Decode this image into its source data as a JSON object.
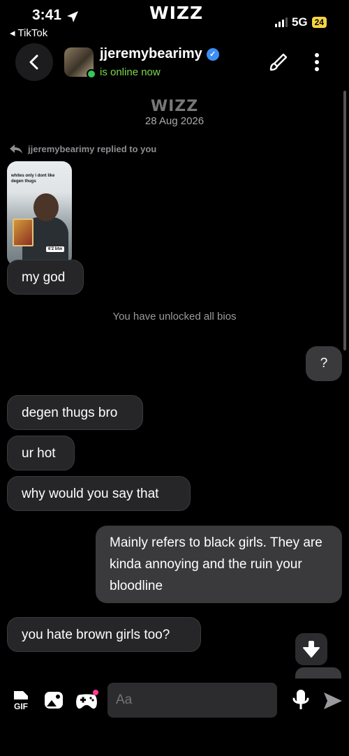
{
  "status_bar": {
    "time": "3:41",
    "back_app": "◂ TikTok",
    "logo": "WIZZ",
    "network": "5G",
    "battery": "24"
  },
  "header": {
    "username": "jjeremybearimy",
    "status": "is online now"
  },
  "conversation": {
    "date_logo": "WIZZ",
    "date": "28 Aug 2026",
    "reply_note": "jjeremybearimy replied to you",
    "thumbnail": {
      "caption": "whites only i dont like degen thugs",
      "tag": "6'2 btw"
    },
    "system_notice": "You have unlocked all bios",
    "messages": [
      {
        "from": "them",
        "text": "my god"
      },
      {
        "from": "me",
        "text": "?"
      },
      {
        "from": "them",
        "text": "degen thugs bro"
      },
      {
        "from": "them",
        "text": "ur hot"
      },
      {
        "from": "them",
        "text": "why would you say that"
      },
      {
        "from": "me",
        "text": "Mainly refers to black girls.  They are kinda annoying and the ruin your bloodline"
      },
      {
        "from": "them",
        "text": "you hate brown girls too?"
      }
    ]
  },
  "composer": {
    "placeholder": "Aa",
    "gif_label": "GIF"
  },
  "colors": {
    "background": "#000000",
    "incoming_bubble": "#262628",
    "outgoing_bubble": "#3a3a3c",
    "online": "#7bd94a",
    "verified": "#3d8ef5"
  }
}
